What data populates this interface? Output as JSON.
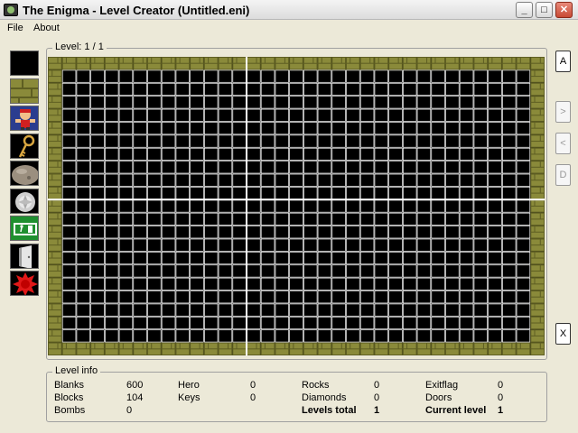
{
  "window": {
    "title": "The Enigma - Level Creator (Untitled.eni)",
    "min_label": "_",
    "max_label": "□",
    "close_label": "✕"
  },
  "menu": {
    "file": "File",
    "about": "About"
  },
  "palette": [
    "blank",
    "block",
    "hero",
    "key",
    "rock",
    "diamond",
    "exit",
    "door",
    "bomb"
  ],
  "level": {
    "label": "Level: 1 / 1",
    "cols": 35,
    "rows": 23
  },
  "side_buttons": {
    "a": "A",
    "next": ">",
    "prev": "<",
    "d": "D",
    "x": "X"
  },
  "info": {
    "label": "Level info",
    "blanks_label": "Blanks",
    "blanks": "600",
    "blocks_label": "Blocks",
    "blocks": "104",
    "bombs_label": "Bombs",
    "bombs": "0",
    "hero_label": "Hero",
    "hero": "0",
    "keys_label": "Keys",
    "keys": "0",
    "rocks_label": "Rocks",
    "rocks": "0",
    "diamonds_label": "Diamonds",
    "diamonds": "0",
    "levels_total_label": "Levels total",
    "levels_total": "1",
    "exitflag_label": "Exitflag",
    "exitflag": "0",
    "doors_label": "Doors",
    "doors": "0",
    "current_level_label": "Current level",
    "current_level": "1"
  },
  "colors": {
    "brick": "#8a8a3a",
    "brick_dark": "#5e5e22",
    "grid": "#ffffff",
    "floor": "#000000"
  }
}
